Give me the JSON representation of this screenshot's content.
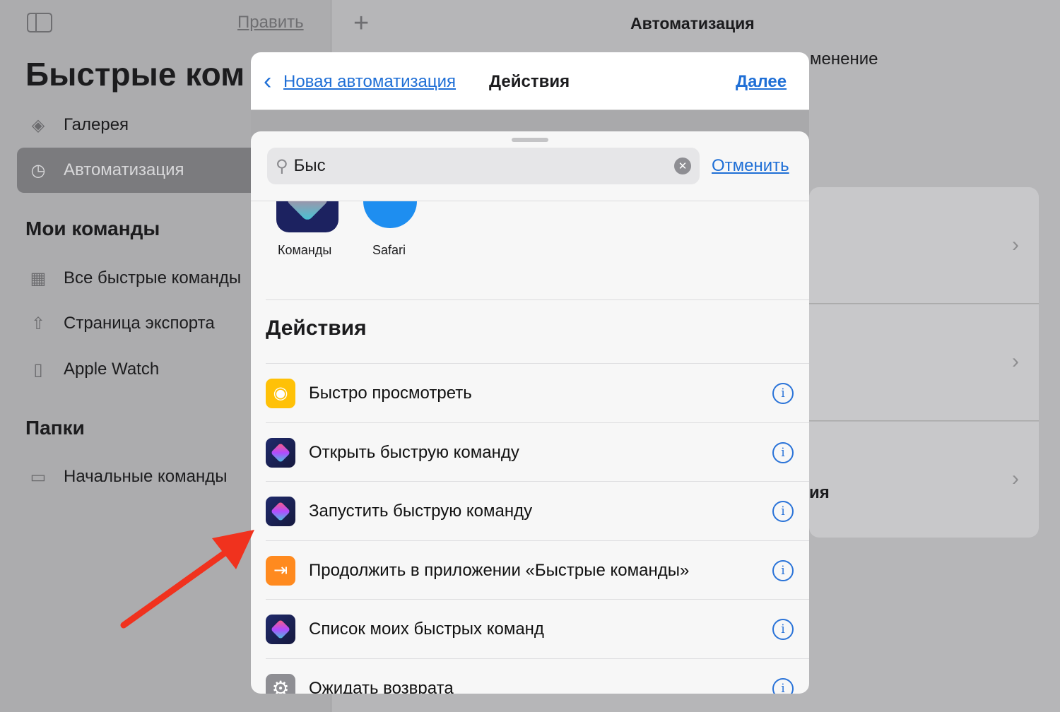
{
  "sidebar": {
    "edit": "Править",
    "title": "Быстрые ком",
    "items": [
      {
        "label": "Галерея",
        "icon": "layers-icon"
      },
      {
        "label": "Автоматизация",
        "icon": "clock-check-icon",
        "selected": true
      }
    ],
    "my_header": "Мои команды",
    "my_items": [
      {
        "label": "Все быстрые команды",
        "icon": "grid-icon"
      },
      {
        "label": "Страница экспорта",
        "icon": "share-icon"
      },
      {
        "label": "Apple Watch",
        "icon": "watch-icon"
      }
    ],
    "folders_header": "Папки",
    "folders": [
      {
        "label": "Начальные команды",
        "icon": "folder-icon"
      }
    ]
  },
  "main": {
    "title": "Автоматизация",
    "partial_text_1": "менение",
    "partial_text_2": "ия"
  },
  "modal": {
    "back": "Новая автоматизация",
    "title": "Действия",
    "next": "Далее",
    "search": {
      "value": "Быс",
      "cancel": "Отменить"
    },
    "apps": [
      {
        "label": "Команды"
      },
      {
        "label": "Safari"
      }
    ],
    "section": "Действия",
    "actions": [
      {
        "label": "Быстро просмотреть",
        "icon": "eye-icon",
        "color": "#ffc107"
      },
      {
        "label": "Открыть быструю команду",
        "icon": "shortcuts-icon"
      },
      {
        "label": "Запустить быструю команду",
        "icon": "shortcuts-icon"
      },
      {
        "label": "Продолжить в приложении «Быстрые команды»",
        "icon": "enter-app-icon",
        "color": "#ff8a1f"
      },
      {
        "label": "Список моих быстрых команд",
        "icon": "shortcuts-icon"
      },
      {
        "label": "Ожидать возврата",
        "icon": "gear-icon",
        "color": "#8e8e93"
      }
    ]
  },
  "annotation": {
    "arrow_color": "#f0321e"
  }
}
